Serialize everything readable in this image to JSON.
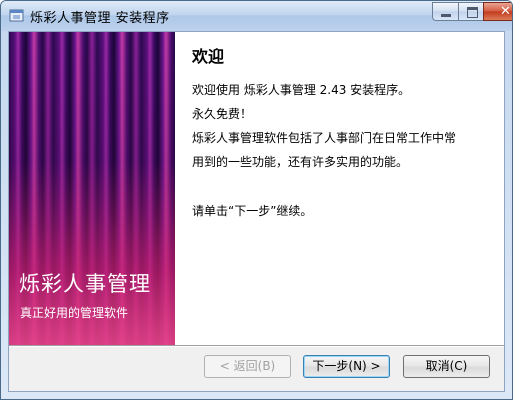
{
  "window": {
    "title": "烁彩人事管理 安装程序"
  },
  "banner": {
    "title": "烁彩人事管理",
    "subtitle": "真正好用的管理软件"
  },
  "content": {
    "heading": "欢迎",
    "line1": "欢迎使用 烁彩人事管理 2.43 安装程序。",
    "line2": "永久免费！",
    "line3": "烁彩人事管理软件包括了人事部门在日常工作中常",
    "line4": "用到的一些功能，还有许多实用的功能。",
    "line5": "请单击“下一步”继续。"
  },
  "buttons": {
    "back": "< 返回(B)",
    "next": "下一步(N) >",
    "cancel": "取消(C)"
  },
  "icons": {
    "app": "installer-icon",
    "minimize": "minimize-icon",
    "maximize": "maximize-icon",
    "close": "close-icon"
  }
}
